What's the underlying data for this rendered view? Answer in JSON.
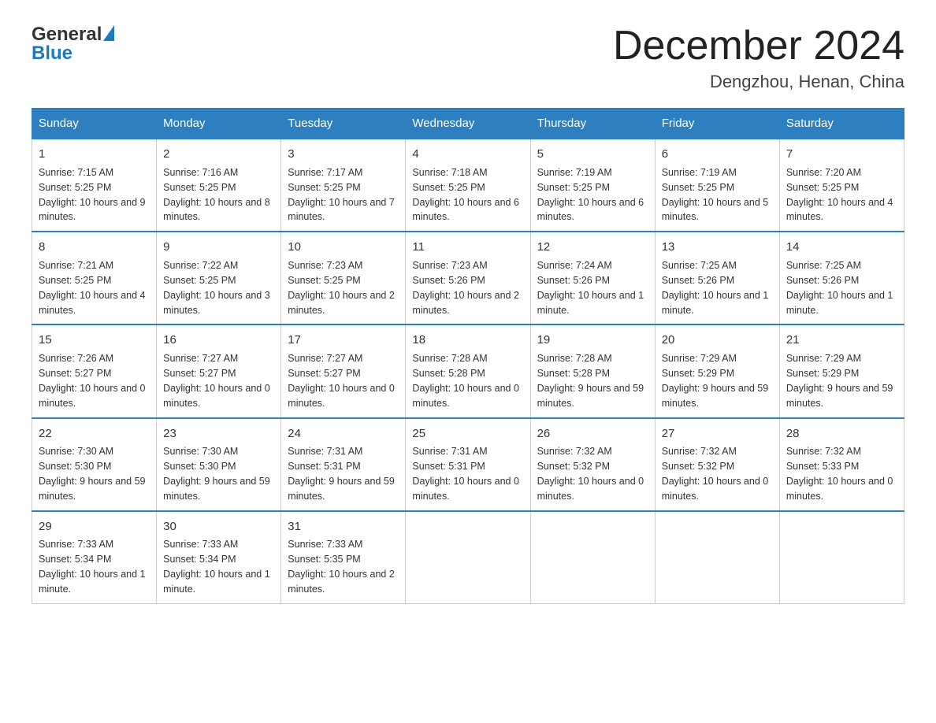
{
  "header": {
    "logo": {
      "general": "General",
      "blue": "Blue"
    },
    "title": "December 2024",
    "subtitle": "Dengzhou, Henan, China"
  },
  "columns": [
    "Sunday",
    "Monday",
    "Tuesday",
    "Wednesday",
    "Thursday",
    "Friday",
    "Saturday"
  ],
  "weeks": [
    [
      {
        "day": "1",
        "sunrise": "7:15 AM",
        "sunset": "5:25 PM",
        "daylight": "10 hours and 9 minutes."
      },
      {
        "day": "2",
        "sunrise": "7:16 AM",
        "sunset": "5:25 PM",
        "daylight": "10 hours and 8 minutes."
      },
      {
        "day": "3",
        "sunrise": "7:17 AM",
        "sunset": "5:25 PM",
        "daylight": "10 hours and 7 minutes."
      },
      {
        "day": "4",
        "sunrise": "7:18 AM",
        "sunset": "5:25 PM",
        "daylight": "10 hours and 6 minutes."
      },
      {
        "day": "5",
        "sunrise": "7:19 AM",
        "sunset": "5:25 PM",
        "daylight": "10 hours and 6 minutes."
      },
      {
        "day": "6",
        "sunrise": "7:19 AM",
        "sunset": "5:25 PM",
        "daylight": "10 hours and 5 minutes."
      },
      {
        "day": "7",
        "sunrise": "7:20 AM",
        "sunset": "5:25 PM",
        "daylight": "10 hours and 4 minutes."
      }
    ],
    [
      {
        "day": "8",
        "sunrise": "7:21 AM",
        "sunset": "5:25 PM",
        "daylight": "10 hours and 4 minutes."
      },
      {
        "day": "9",
        "sunrise": "7:22 AM",
        "sunset": "5:25 PM",
        "daylight": "10 hours and 3 minutes."
      },
      {
        "day": "10",
        "sunrise": "7:23 AM",
        "sunset": "5:25 PM",
        "daylight": "10 hours and 2 minutes."
      },
      {
        "day": "11",
        "sunrise": "7:23 AM",
        "sunset": "5:26 PM",
        "daylight": "10 hours and 2 minutes."
      },
      {
        "day": "12",
        "sunrise": "7:24 AM",
        "sunset": "5:26 PM",
        "daylight": "10 hours and 1 minute."
      },
      {
        "day": "13",
        "sunrise": "7:25 AM",
        "sunset": "5:26 PM",
        "daylight": "10 hours and 1 minute."
      },
      {
        "day": "14",
        "sunrise": "7:25 AM",
        "sunset": "5:26 PM",
        "daylight": "10 hours and 1 minute."
      }
    ],
    [
      {
        "day": "15",
        "sunrise": "7:26 AM",
        "sunset": "5:27 PM",
        "daylight": "10 hours and 0 minutes."
      },
      {
        "day": "16",
        "sunrise": "7:27 AM",
        "sunset": "5:27 PM",
        "daylight": "10 hours and 0 minutes."
      },
      {
        "day": "17",
        "sunrise": "7:27 AM",
        "sunset": "5:27 PM",
        "daylight": "10 hours and 0 minutes."
      },
      {
        "day": "18",
        "sunrise": "7:28 AM",
        "sunset": "5:28 PM",
        "daylight": "10 hours and 0 minutes."
      },
      {
        "day": "19",
        "sunrise": "7:28 AM",
        "sunset": "5:28 PM",
        "daylight": "9 hours and 59 minutes."
      },
      {
        "day": "20",
        "sunrise": "7:29 AM",
        "sunset": "5:29 PM",
        "daylight": "9 hours and 59 minutes."
      },
      {
        "day": "21",
        "sunrise": "7:29 AM",
        "sunset": "5:29 PM",
        "daylight": "9 hours and 59 minutes."
      }
    ],
    [
      {
        "day": "22",
        "sunrise": "7:30 AM",
        "sunset": "5:30 PM",
        "daylight": "9 hours and 59 minutes."
      },
      {
        "day": "23",
        "sunrise": "7:30 AM",
        "sunset": "5:30 PM",
        "daylight": "9 hours and 59 minutes."
      },
      {
        "day": "24",
        "sunrise": "7:31 AM",
        "sunset": "5:31 PM",
        "daylight": "9 hours and 59 minutes."
      },
      {
        "day": "25",
        "sunrise": "7:31 AM",
        "sunset": "5:31 PM",
        "daylight": "10 hours and 0 minutes."
      },
      {
        "day": "26",
        "sunrise": "7:32 AM",
        "sunset": "5:32 PM",
        "daylight": "10 hours and 0 minutes."
      },
      {
        "day": "27",
        "sunrise": "7:32 AM",
        "sunset": "5:32 PM",
        "daylight": "10 hours and 0 minutes."
      },
      {
        "day": "28",
        "sunrise": "7:32 AM",
        "sunset": "5:33 PM",
        "daylight": "10 hours and 0 minutes."
      }
    ],
    [
      {
        "day": "29",
        "sunrise": "7:33 AM",
        "sunset": "5:34 PM",
        "daylight": "10 hours and 1 minute."
      },
      {
        "day": "30",
        "sunrise": "7:33 AM",
        "sunset": "5:34 PM",
        "daylight": "10 hours and 1 minute."
      },
      {
        "day": "31",
        "sunrise": "7:33 AM",
        "sunset": "5:35 PM",
        "daylight": "10 hours and 2 minutes."
      },
      null,
      null,
      null,
      null
    ]
  ],
  "labels": {
    "sunrise": "Sunrise:",
    "sunset": "Sunset:",
    "daylight": "Daylight:"
  }
}
